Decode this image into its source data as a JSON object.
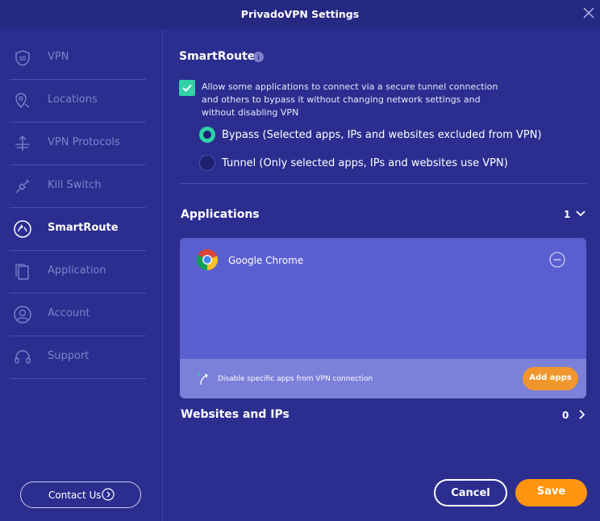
{
  "window": {
    "title": "PrivadoVPN Settings"
  },
  "sidebar": {
    "items": [
      {
        "label": "VPN",
        "icon": "shield-icon"
      },
      {
        "label": "Locations",
        "icon": "location-pin-icon"
      },
      {
        "label": "VPN Protocols",
        "icon": "protocols-icon"
      },
      {
        "label": "Kill Switch",
        "icon": "plug-icon"
      },
      {
        "label": "SmartRoute",
        "icon": "smartroute-icon",
        "active": true
      },
      {
        "label": "Application",
        "icon": "application-icon"
      },
      {
        "label": "Account",
        "icon": "account-icon"
      },
      {
        "label": "Support",
        "icon": "headset-icon"
      }
    ],
    "contact_label": "Contact Us"
  },
  "smartroute": {
    "title": "SmartRoute",
    "checkbox_checked": true,
    "checkbox_text": "Allow some applications to connect via a secure tunnel connection and others to bypass it without changing network settings and without disabling VPN",
    "bypass_label": "Bypass (Selected apps, IPs and websites excluded from VPN)",
    "tunnel_label": "Tunnel (Only selected apps, IPs and websites use VPN)",
    "selected_mode": "Bypass"
  },
  "applications": {
    "title": "Applications",
    "count": "1",
    "items": [
      {
        "name": "Google Chrome"
      }
    ],
    "footer_text": "Disable specific apps from VPN connection",
    "add_label": "Add apps"
  },
  "websites": {
    "title": "Websites and IPs",
    "count": "0"
  },
  "actions": {
    "cancel_label": "Cancel",
    "save_label": "Save"
  },
  "colors": {
    "background": "#2b2e8f",
    "accent_green": "#2fd3a5",
    "accent_orange": "#ff9411",
    "panel": "#5a5fcf"
  }
}
